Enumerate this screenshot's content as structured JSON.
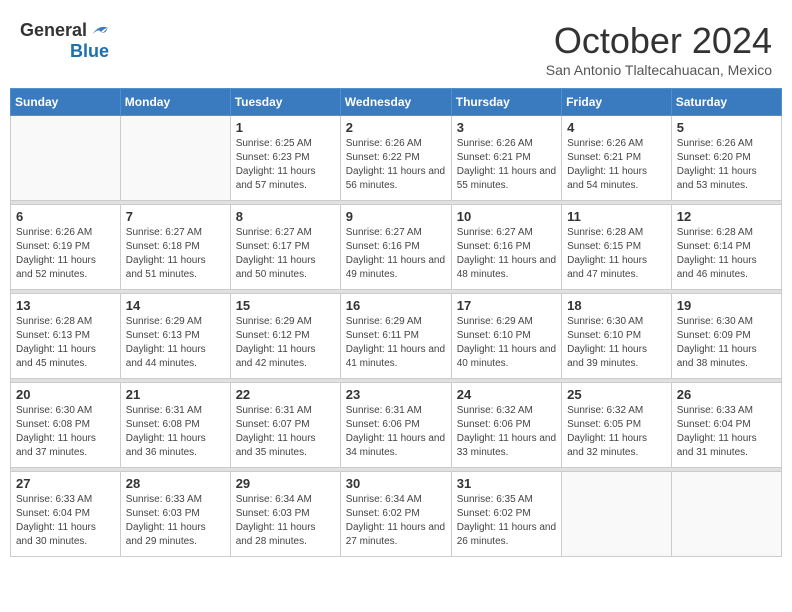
{
  "header": {
    "logo_general": "General",
    "logo_blue": "Blue",
    "month": "October 2024",
    "location": "San Antonio Tlaltecahuacan, Mexico"
  },
  "weekdays": [
    "Sunday",
    "Monday",
    "Tuesday",
    "Wednesday",
    "Thursday",
    "Friday",
    "Saturday"
  ],
  "weeks": [
    [
      {
        "day": "",
        "sunrise": "",
        "sunset": "",
        "daylight": ""
      },
      {
        "day": "",
        "sunrise": "",
        "sunset": "",
        "daylight": ""
      },
      {
        "day": "1",
        "sunrise": "Sunrise: 6:25 AM",
        "sunset": "Sunset: 6:23 PM",
        "daylight": "Daylight: 11 hours and 57 minutes."
      },
      {
        "day": "2",
        "sunrise": "Sunrise: 6:26 AM",
        "sunset": "Sunset: 6:22 PM",
        "daylight": "Daylight: 11 hours and 56 minutes."
      },
      {
        "day": "3",
        "sunrise": "Sunrise: 6:26 AM",
        "sunset": "Sunset: 6:21 PM",
        "daylight": "Daylight: 11 hours and 55 minutes."
      },
      {
        "day": "4",
        "sunrise": "Sunrise: 6:26 AM",
        "sunset": "Sunset: 6:21 PM",
        "daylight": "Daylight: 11 hours and 54 minutes."
      },
      {
        "day": "5",
        "sunrise": "Sunrise: 6:26 AM",
        "sunset": "Sunset: 6:20 PM",
        "daylight": "Daylight: 11 hours and 53 minutes."
      }
    ],
    [
      {
        "day": "6",
        "sunrise": "Sunrise: 6:26 AM",
        "sunset": "Sunset: 6:19 PM",
        "daylight": "Daylight: 11 hours and 52 minutes."
      },
      {
        "day": "7",
        "sunrise": "Sunrise: 6:27 AM",
        "sunset": "Sunset: 6:18 PM",
        "daylight": "Daylight: 11 hours and 51 minutes."
      },
      {
        "day": "8",
        "sunrise": "Sunrise: 6:27 AM",
        "sunset": "Sunset: 6:17 PM",
        "daylight": "Daylight: 11 hours and 50 minutes."
      },
      {
        "day": "9",
        "sunrise": "Sunrise: 6:27 AM",
        "sunset": "Sunset: 6:16 PM",
        "daylight": "Daylight: 11 hours and 49 minutes."
      },
      {
        "day": "10",
        "sunrise": "Sunrise: 6:27 AM",
        "sunset": "Sunset: 6:16 PM",
        "daylight": "Daylight: 11 hours and 48 minutes."
      },
      {
        "day": "11",
        "sunrise": "Sunrise: 6:28 AM",
        "sunset": "Sunset: 6:15 PM",
        "daylight": "Daylight: 11 hours and 47 minutes."
      },
      {
        "day": "12",
        "sunrise": "Sunrise: 6:28 AM",
        "sunset": "Sunset: 6:14 PM",
        "daylight": "Daylight: 11 hours and 46 minutes."
      }
    ],
    [
      {
        "day": "13",
        "sunrise": "Sunrise: 6:28 AM",
        "sunset": "Sunset: 6:13 PM",
        "daylight": "Daylight: 11 hours and 45 minutes."
      },
      {
        "day": "14",
        "sunrise": "Sunrise: 6:29 AM",
        "sunset": "Sunset: 6:13 PM",
        "daylight": "Daylight: 11 hours and 44 minutes."
      },
      {
        "day": "15",
        "sunrise": "Sunrise: 6:29 AM",
        "sunset": "Sunset: 6:12 PM",
        "daylight": "Daylight: 11 hours and 42 minutes."
      },
      {
        "day": "16",
        "sunrise": "Sunrise: 6:29 AM",
        "sunset": "Sunset: 6:11 PM",
        "daylight": "Daylight: 11 hours and 41 minutes."
      },
      {
        "day": "17",
        "sunrise": "Sunrise: 6:29 AM",
        "sunset": "Sunset: 6:10 PM",
        "daylight": "Daylight: 11 hours and 40 minutes."
      },
      {
        "day": "18",
        "sunrise": "Sunrise: 6:30 AM",
        "sunset": "Sunset: 6:10 PM",
        "daylight": "Daylight: 11 hours and 39 minutes."
      },
      {
        "day": "19",
        "sunrise": "Sunrise: 6:30 AM",
        "sunset": "Sunset: 6:09 PM",
        "daylight": "Daylight: 11 hours and 38 minutes."
      }
    ],
    [
      {
        "day": "20",
        "sunrise": "Sunrise: 6:30 AM",
        "sunset": "Sunset: 6:08 PM",
        "daylight": "Daylight: 11 hours and 37 minutes."
      },
      {
        "day": "21",
        "sunrise": "Sunrise: 6:31 AM",
        "sunset": "Sunset: 6:08 PM",
        "daylight": "Daylight: 11 hours and 36 minutes."
      },
      {
        "day": "22",
        "sunrise": "Sunrise: 6:31 AM",
        "sunset": "Sunset: 6:07 PM",
        "daylight": "Daylight: 11 hours and 35 minutes."
      },
      {
        "day": "23",
        "sunrise": "Sunrise: 6:31 AM",
        "sunset": "Sunset: 6:06 PM",
        "daylight": "Daylight: 11 hours and 34 minutes."
      },
      {
        "day": "24",
        "sunrise": "Sunrise: 6:32 AM",
        "sunset": "Sunset: 6:06 PM",
        "daylight": "Daylight: 11 hours and 33 minutes."
      },
      {
        "day": "25",
        "sunrise": "Sunrise: 6:32 AM",
        "sunset": "Sunset: 6:05 PM",
        "daylight": "Daylight: 11 hours and 32 minutes."
      },
      {
        "day": "26",
        "sunrise": "Sunrise: 6:33 AM",
        "sunset": "Sunset: 6:04 PM",
        "daylight": "Daylight: 11 hours and 31 minutes."
      }
    ],
    [
      {
        "day": "27",
        "sunrise": "Sunrise: 6:33 AM",
        "sunset": "Sunset: 6:04 PM",
        "daylight": "Daylight: 11 hours and 30 minutes."
      },
      {
        "day": "28",
        "sunrise": "Sunrise: 6:33 AM",
        "sunset": "Sunset: 6:03 PM",
        "daylight": "Daylight: 11 hours and 29 minutes."
      },
      {
        "day": "29",
        "sunrise": "Sunrise: 6:34 AM",
        "sunset": "Sunset: 6:03 PM",
        "daylight": "Daylight: 11 hours and 28 minutes."
      },
      {
        "day": "30",
        "sunrise": "Sunrise: 6:34 AM",
        "sunset": "Sunset: 6:02 PM",
        "daylight": "Daylight: 11 hours and 27 minutes."
      },
      {
        "day": "31",
        "sunrise": "Sunrise: 6:35 AM",
        "sunset": "Sunset: 6:02 PM",
        "daylight": "Daylight: 11 hours and 26 minutes."
      },
      {
        "day": "",
        "sunrise": "",
        "sunset": "",
        "daylight": ""
      },
      {
        "day": "",
        "sunrise": "",
        "sunset": "",
        "daylight": ""
      }
    ]
  ]
}
